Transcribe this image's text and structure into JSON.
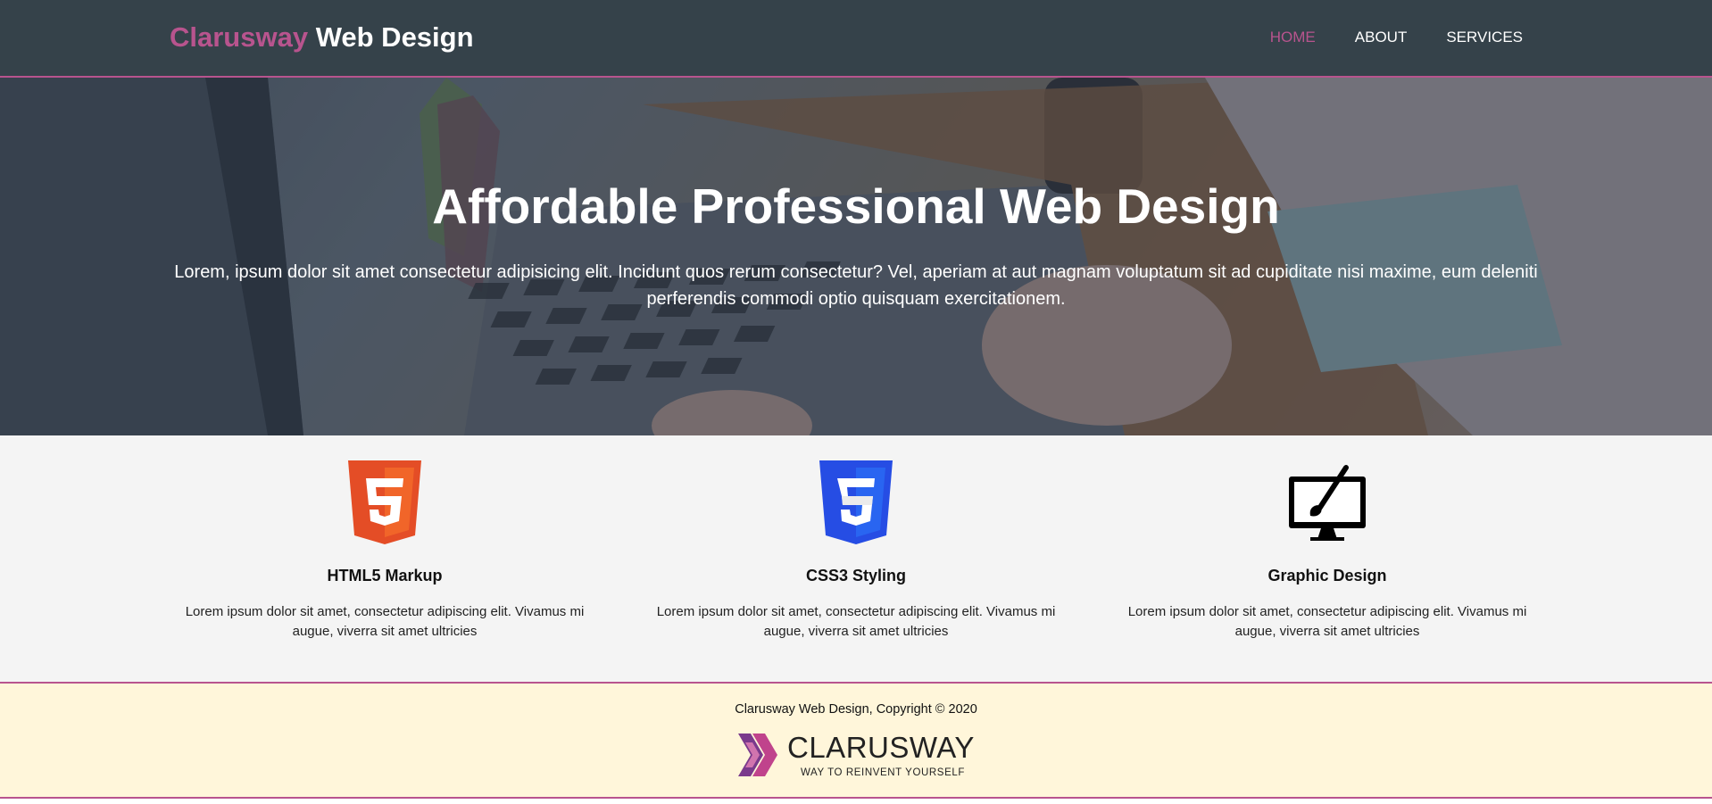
{
  "header": {
    "brand_accent": "Clarusway",
    "brand_rest": " Web Design",
    "nav": [
      {
        "label": "HOME",
        "active": true
      },
      {
        "label": "ABOUT",
        "active": false
      },
      {
        "label": "SERVICES",
        "active": false
      }
    ]
  },
  "hero": {
    "title": "Affordable Professional Web Design",
    "text": "Lorem, ipsum dolor sit amet consectetur adipisicing elit. Incidunt quos rerum consectetur? Vel, aperiam at aut magnam voluptatum sit ad cupiditate nisi maxime, eum deleniti perferendis commodi optio quisquam exercitationem."
  },
  "features": [
    {
      "icon": "html5-icon",
      "title": "HTML5 Markup",
      "text": "Lorem ipsum dolor sit amet, consectetur adipiscing elit. Vivamus mi augue, viverra sit amet ultricies"
    },
    {
      "icon": "css3-icon",
      "title": "CSS3 Styling",
      "text": "Lorem ipsum dolor sit amet, consectetur adipiscing elit. Vivamus mi augue, viverra sit amet ultricies"
    },
    {
      "icon": "graphic-design-icon",
      "title": "Graphic Design",
      "text": "Lorem ipsum dolor sit amet, consectetur adipiscing elit. Vivamus mi augue, viverra sit amet ultricies"
    }
  ],
  "footer": {
    "copyright": "Clarusway Web Design, Copyright © 2020",
    "logo_word": "CLARUSWAY",
    "logo_tagline": "WAY TO REINVENT YOURSELF"
  },
  "colors": {
    "header_bg": "#35424a",
    "accent": "#b8548e",
    "features_bg": "#f4f4f4",
    "footer_bg": "#fff6da"
  }
}
